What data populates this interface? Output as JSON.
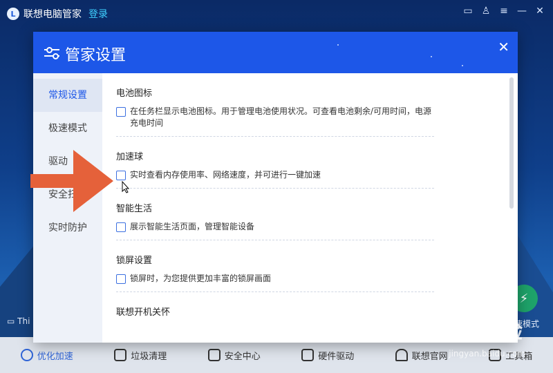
{
  "app": {
    "name": "联想电脑管家",
    "login": "登录",
    "left_status": "Thi",
    "right_status": "速模式"
  },
  "bottom_bar": [
    {
      "label": "优化加速",
      "icon": "speedometer-icon",
      "active": true
    },
    {
      "label": "垃圾清理",
      "icon": "trash-icon"
    },
    {
      "label": "安全中心",
      "icon": "shield-icon"
    },
    {
      "label": "硬件驱动",
      "icon": "hardware-icon"
    },
    {
      "label": "联想官网",
      "icon": "headset-icon"
    },
    {
      "label": "工具箱",
      "icon": "toolbox-icon"
    }
  ],
  "dialog": {
    "title": "管家设置",
    "sidebar": [
      {
        "label": "常规设置"
      },
      {
        "label": "极速模式"
      },
      {
        "label": "驱动"
      },
      {
        "label": "安全扫描"
      },
      {
        "label": "实时防护"
      }
    ],
    "sections": [
      {
        "title": "电池图标",
        "option": "在任务栏显示电池图标。用于管理电池使用状况。可查看电池剩余/可用时间，电源充电时间"
      },
      {
        "title": "加速球",
        "option": "实时查看内存使用率、网络速度，并可进行一键加速"
      },
      {
        "title": "智能生活",
        "option": "展示智能生活页面，管理智能设备"
      },
      {
        "title": "锁屏设置",
        "option": "锁屏时，为您提供更加丰富的锁屏画面"
      },
      {
        "title": "联想开机关怀",
        "option": ""
      }
    ]
  },
  "watermark": {
    "text": "Baidu经验",
    "url": "jingyan.baidu.com"
  },
  "colors": {
    "accent": "#1d57e8",
    "arrow": "#e5613a"
  }
}
